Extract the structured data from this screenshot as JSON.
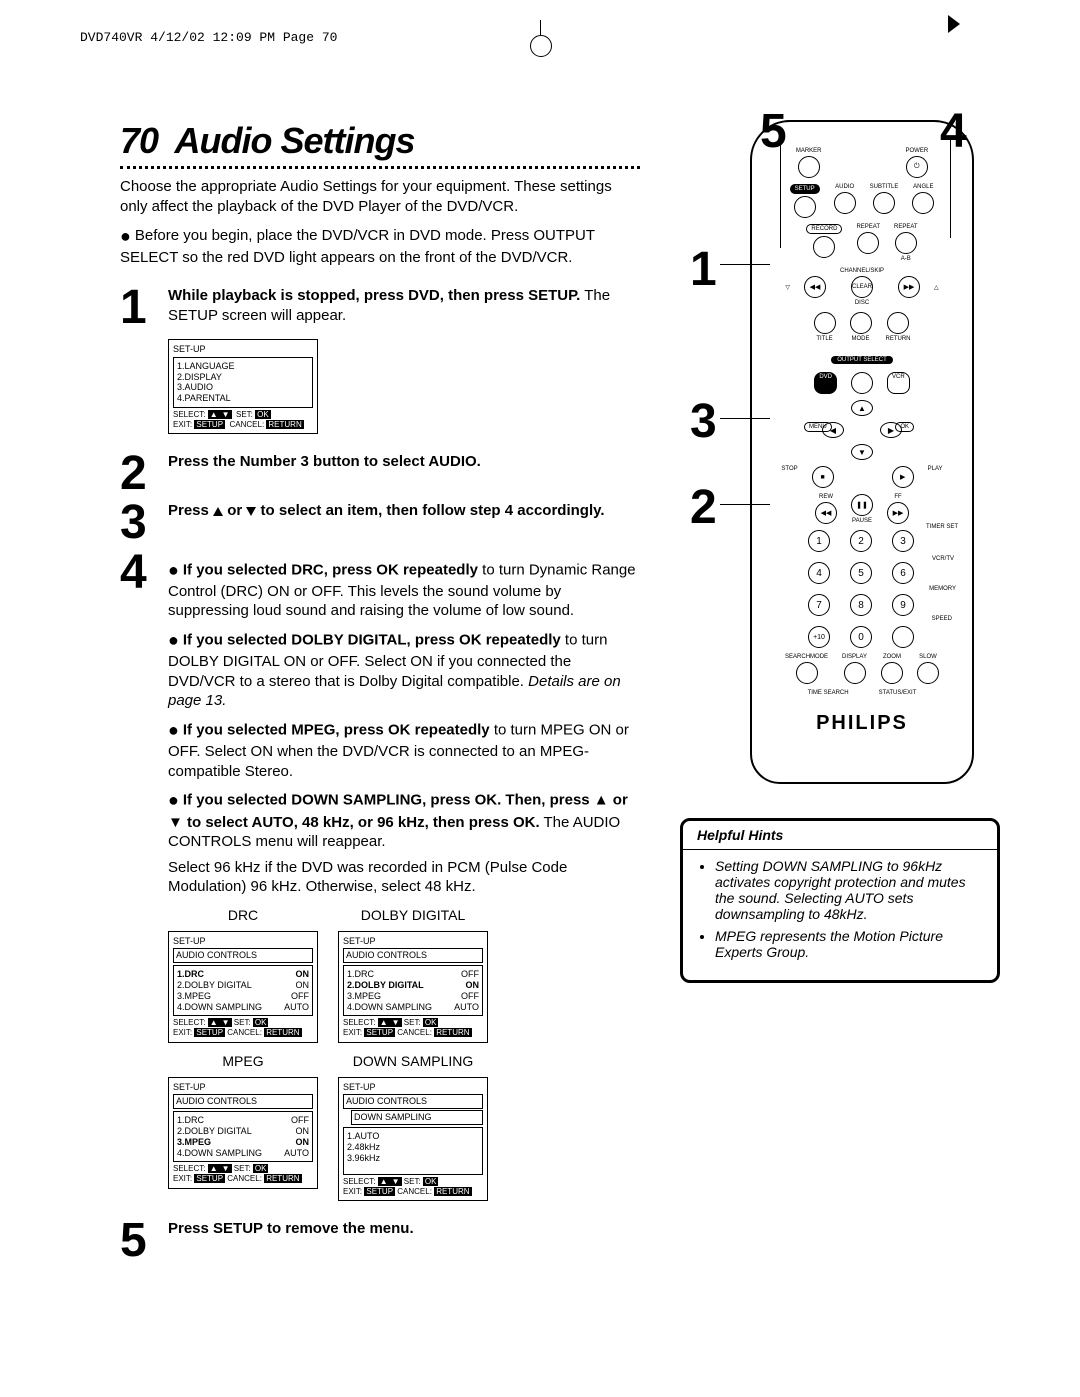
{
  "header": "DVD740VR  4/12/02  12:09 PM  Page 70",
  "page_num": "70",
  "title": "Audio Settings",
  "intro": "Choose the appropriate Audio Settings for your equipment. These settings only affect the playback of the DVD Player of the DVD/VCR.",
  "intro_bullet": "Before you begin, place the DVD/VCR in DVD mode. Press OUTPUT SELECT so the red DVD light appears on the front of the DVD/VCR.",
  "step1": {
    "bold": "While playback is stopped, press DVD, then press SETUP.",
    "rest": " The SETUP screen will appear."
  },
  "setup_screen": {
    "title": "SET-UP",
    "items": [
      "1.LANGUAGE",
      "2.DISPLAY",
      "3.AUDIO",
      "4.PARENTAL"
    ],
    "foot_select": "SELECT:",
    "foot_set": "SET:",
    "foot_ok": "OK",
    "foot_exit": "EXIT:",
    "foot_setup": "SETUP",
    "foot_cancel": "CANCEL:",
    "foot_return": "RETURN"
  },
  "step2": "Press the Number 3 button to select AUDIO.",
  "step3_a": "Press ",
  "step3_b": " or ",
  "step3_c": " to select an item, then follow step 4 accordingly.",
  "step4": {
    "drc_bold": "If you selected DRC, press OK repeatedly",
    "drc_rest": " to turn Dynamic Range Control (DRC) ON or OFF. This levels the sound volume by suppressing loud sound and raising the volume of low sound.",
    "dolby_bold": "If you selected DOLBY DIGITAL, press OK repeatedly",
    "dolby_rest": " to turn DOLBY DIGITAL ON or OFF. Select ON if you connected the DVD/VCR to a stereo that is Dolby Digital compatible. ",
    "dolby_italic": "Details are on page 13.",
    "mpeg_bold": "If you selected MPEG, press OK repeatedly",
    "mpeg_rest": " to turn MPEG ON or OFF. Select ON when the DVD/VCR is connected to an MPEG-compatible Stereo.",
    "down_bold": "If you selected DOWN SAMPLING, press OK. Then, press ▲ or ▼ to select AUTO, 48 kHz, or 96 kHz, then press OK.",
    "down_rest": " The AUDIO CONTROLS menu will reappear.",
    "pcm": "Select 96 kHz if the DVD was recorded in PCM (Pulse Code Modulation) 96 kHz. Otherwise, select 48 kHz."
  },
  "screens": {
    "drc_caption": "DRC",
    "drc_rows": [
      [
        "1.DRC",
        "ON"
      ],
      [
        "2.DOLBY DIGITAL",
        "ON"
      ],
      [
        "3.MPEG",
        "OFF"
      ],
      [
        "4.DOWN SAMPLING",
        "AUTO"
      ]
    ],
    "dolby_caption": "DOLBY DIGITAL",
    "dolby_rows": [
      [
        "1.DRC",
        "OFF"
      ],
      [
        "2.DOLBY DIGITAL",
        "ON"
      ],
      [
        "3.MPEG",
        "OFF"
      ],
      [
        "4.DOWN SAMPLING",
        "AUTO"
      ]
    ],
    "mpeg_caption": "MPEG",
    "mpeg_rows": [
      [
        "1.DRC",
        "OFF"
      ],
      [
        "2.DOLBY DIGITAL",
        "ON"
      ],
      [
        "3.MPEG",
        "ON"
      ],
      [
        "4.DOWN SAMPLING",
        "AUTO"
      ]
    ],
    "down_caption": "DOWN SAMPLING",
    "down_hdr2": "DOWN SAMPLING",
    "down_rows": [
      [
        "1.AUTO",
        ""
      ],
      [
        "2.48kHz",
        ""
      ],
      [
        "3.96kHz",
        ""
      ]
    ],
    "audio_controls": "AUDIO CONTROLS"
  },
  "step5": "Press SETUP to remove the menu.",
  "remote": {
    "brand": "PHILIPS",
    "labels": {
      "marker": "MARKER",
      "power": "POWER",
      "setup": "SETUP",
      "audio": "AUDIO",
      "subtitle": "SUBTITLE",
      "angle": "ANGLE",
      "record": "RECORD",
      "repeat": "REPEAT",
      "ab": "A-B",
      "channel": "CHANNEL/SKIP",
      "title": "TITLE",
      "disc": "DISC",
      "mode": "MODE",
      "return": "RETURN",
      "output": "OUTPUT SELECT",
      "dvd": "DVD",
      "vcr": "VCR",
      "menu": "MENU",
      "ok": "OK",
      "stop": "STOP",
      "play": "PLAY",
      "rew": "REW",
      "pause": "PAUSE",
      "ff": "FF",
      "timerset": "TIMER SET",
      "vcrtv": "VCR/TV",
      "memory": "MEMORY",
      "speed": "SPEED",
      "searchmode": "SEARCHMODE",
      "display": "DISPLAY",
      "zoom": "ZOOM",
      "slow": "SLOW",
      "timesearch": "TIME SEARCH",
      "status": "STATUS/EXIT",
      "clear": "CLEAR",
      "plus10": "+10"
    },
    "callouts": {
      "c1": "1",
      "c2": "2",
      "c3": "3",
      "c4": "4",
      "c5": "5"
    }
  },
  "hints": {
    "title": "Helpful Hints",
    "h1": "Setting DOWN SAMPLING to 96kHz activates copyright protection and mutes the sound. Selecting AUTO sets downsampling to 48kHz.",
    "h2": "MPEG represents the Motion Picture Experts Group."
  }
}
